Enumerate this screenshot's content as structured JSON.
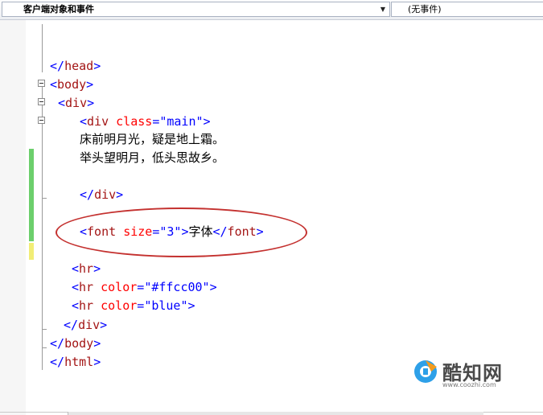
{
  "toolbar": {
    "object_dropdown_label": "客户端对象和事件",
    "event_dropdown_label": "(无事件)",
    "dropdown_arrow": "▼"
  },
  "code_lines": [
    {
      "kind": "close",
      "tag": "head"
    },
    {
      "kind": "open",
      "tag": "body"
    },
    {
      "kind": "open",
      "tag": "div"
    },
    {
      "kind": "open_attr",
      "tag": "div",
      "attr": "class",
      "value": "\"main\""
    },
    {
      "kind": "text",
      "text": "床前明月光，疑是地上霜。"
    },
    {
      "kind": "text",
      "text": "举头望明月，低头思故乡。"
    },
    {
      "kind": "close",
      "tag": "div"
    },
    {
      "kind": "font",
      "tag": "font",
      "attr": "size",
      "value": "\"3\"",
      "content": "字体"
    },
    {
      "kind": "open",
      "tag": "hr"
    },
    {
      "kind": "open_attr",
      "tag": "hr",
      "attr": "color",
      "value": "\"#ffcc00\""
    },
    {
      "kind": "open_attr",
      "tag": "hr",
      "attr": "color",
      "value": "\"blue\""
    },
    {
      "kind": "close",
      "tag": "div"
    },
    {
      "kind": "close",
      "tag": "body"
    },
    {
      "kind": "close",
      "tag": "html"
    }
  ],
  "change_bars": {
    "saved": "#6ccf6c",
    "unsaved": "#f1ed76"
  },
  "annotation": {
    "color": "#c4312f",
    "shape": "ellipse"
  },
  "watermark": {
    "brand": "酷知网",
    "url": "www.coozhi.com",
    "logo_icon": "coozhi-logo-icon"
  }
}
